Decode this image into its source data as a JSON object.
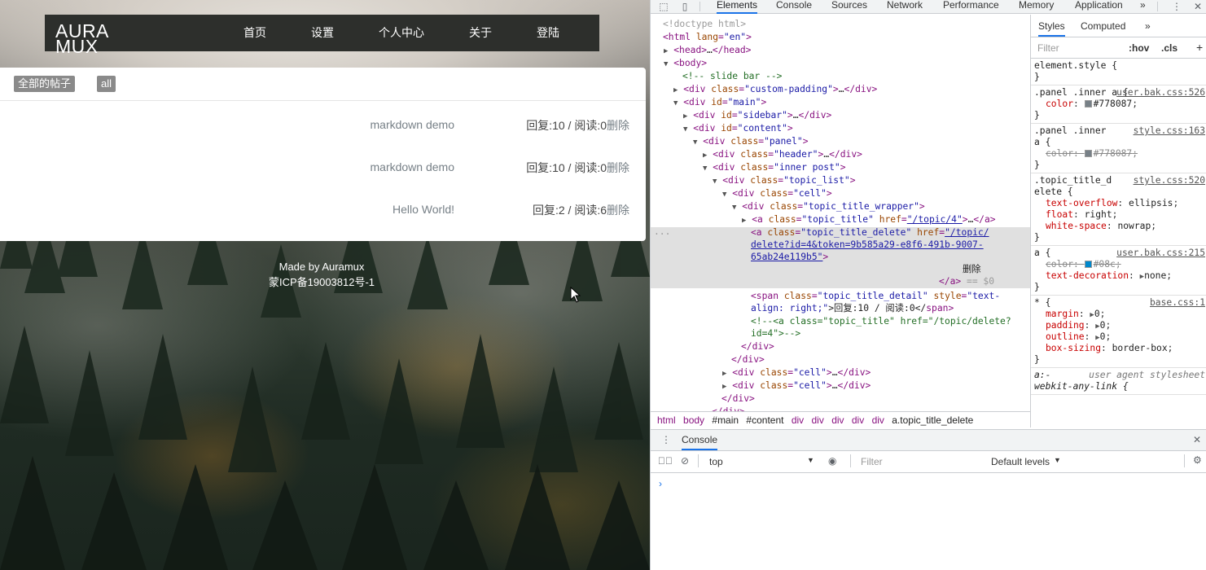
{
  "site": {
    "logo_line1": "AURA",
    "logo_line2": "MUX",
    "nav": [
      "首页",
      "设置",
      "个人中心",
      "关于",
      "登陆"
    ],
    "tabs": [
      "全部的帖子",
      "all"
    ],
    "topics": [
      {
        "title": "markdown demo",
        "detail": "回复:10 / 阅读:0",
        "delete": "删除"
      },
      {
        "title": "markdown demo",
        "detail": "回复:10 / 阅读:0",
        "delete": "删除"
      },
      {
        "title": "Hello World!",
        "detail": "回复:2 / 阅读:6",
        "delete": "删除"
      }
    ],
    "footer_line1": "Made by Auramux",
    "footer_line2": "蒙ICP备19003812号-1"
  },
  "devtools": {
    "tabs": [
      "Elements",
      "Console",
      "Sources",
      "Network",
      "Performance",
      "Memory",
      "Application"
    ],
    "more": "»",
    "active_tab": "Elements",
    "styles_tabs": [
      "Styles",
      "Computed"
    ],
    "styles_more": "»",
    "filter_placeholder": "Filter",
    "hov": ":hov",
    "cls": ".cls",
    "plus": "+",
    "dom": {
      "l1": "<!doctype html>",
      "c1": "<!-- slide bar -->",
      "selected_text": "删除",
      "eq0": "== $0",
      "span_text": ">回复:10 / 阅读:0</",
      "c2a": "<!--<a class=\"topic_title\" href=\"/topic/delete?",
      "c2b": "id=4\">-->"
    },
    "breadcrumb": [
      "html",
      "body",
      "#main",
      "#content",
      "div",
      "div",
      "div",
      "div",
      "div",
      "a.topic_title_delete"
    ],
    "styles": {
      "element_style": "element.style {",
      "r1_sel": ".panel .inner a {",
      "r1_src": "user.bak.css:526",
      "r1_prop": "color",
      "r1_val": "#778087",
      "r2_sel1": ".panel .inner",
      "r2_sel2": "a {",
      "r2_src": "style.css:163",
      "r2_prop": "color",
      "r2_val": "#778087",
      "r3_sel1": ".topic_title_d",
      "r3_sel2": "elete {",
      "r3_src": "style.css:520",
      "r3_p1": "text-overflow",
      "r3_v1": "ellipsis",
      "r3_p2": "float",
      "r3_v2": "right",
      "r3_p3": "white-space",
      "r3_v3": "nowrap",
      "r4_sel": "a {",
      "r4_src": "user.bak.css:215",
      "r4_p1": "color",
      "r4_v1": "#08c",
      "r4_p2": "text-decoration",
      "r4_v2": "none",
      "r5_sel": "* {",
      "r5_src": "base.css:1",
      "r5_p1": "margin",
      "r5_v1": "0",
      "r5_p2": "padding",
      "r5_v2": "0",
      "r5_p3": "outline",
      "r5_v3": "0",
      "r5_p4": "box-sizing",
      "r5_v4": "border-box",
      "r6_sel1": "a:-",
      "r6_src": "user agent stylesheet",
      "r6_sel2": "webkit-any-link {"
    },
    "console": {
      "drawer_tab": "Console",
      "context": "top",
      "filter_placeholder": "Filter",
      "levels": "Default levels"
    }
  },
  "colors": {
    "navbar": "#2d2f2c",
    "link_grey": "#778087",
    "accent_blue": "#1a73e8",
    "tag_purple": "#881280"
  }
}
